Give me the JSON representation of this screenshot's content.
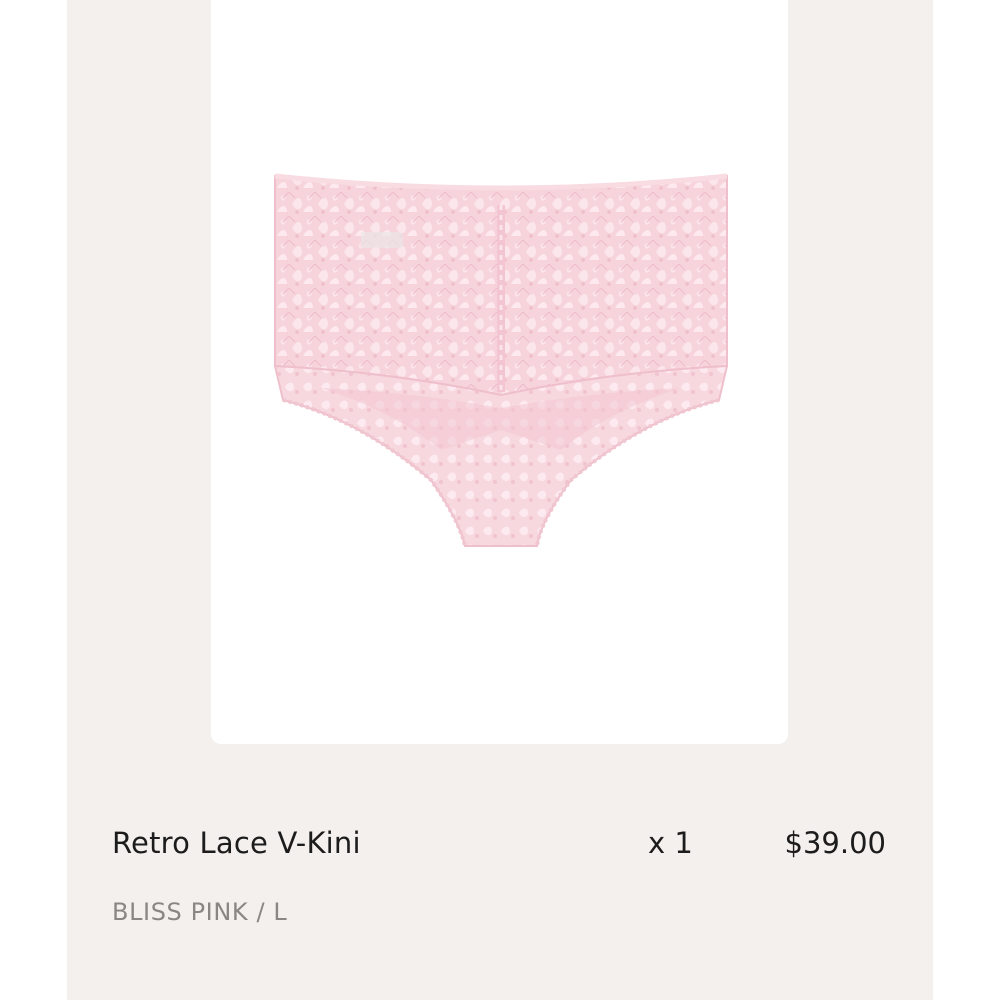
{
  "order_item": {
    "name": "Retro Lace V-Kini",
    "quantity_label": "x 1",
    "price": "$39.00",
    "variant": "BLISS PINK / L",
    "image": {
      "subject": "pink lace v-kini panty",
      "icon": "product-photo"
    }
  },
  "colors": {
    "panel_background": "#f4f0ed",
    "card_background": "#ffffff",
    "product_pink": "#f6cfd8",
    "primary_text": "#1c1c1c",
    "secondary_text": "#8a8683"
  }
}
